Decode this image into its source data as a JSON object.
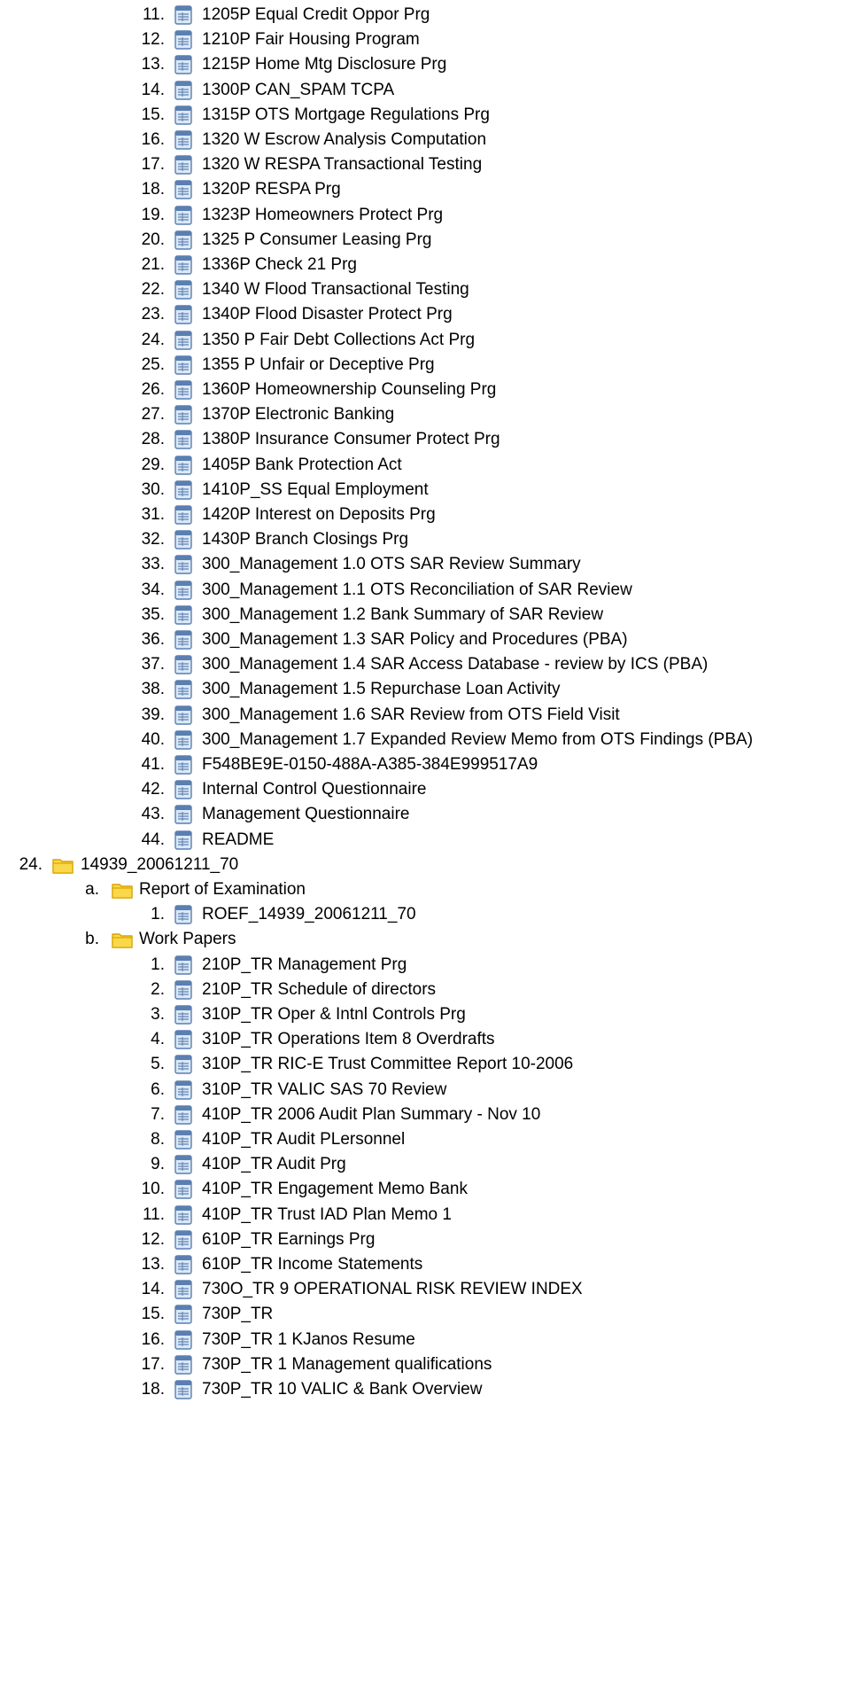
{
  "icons": {
    "folder": "folder-icon",
    "document": "document-icon"
  },
  "colors": {
    "folder_fill": "#f9d94a",
    "folder_edge": "#d9a400",
    "doc_fill": "#dbe8f6",
    "doc_edge": "#5a7fb0"
  },
  "rows": [
    {
      "level": 2,
      "num": "11.",
      "icon": "document",
      "text": "1205P Equal Credit Oppor Prg"
    },
    {
      "level": 2,
      "num": "12.",
      "icon": "document",
      "text": "1210P Fair Housing Program"
    },
    {
      "level": 2,
      "num": "13.",
      "icon": "document",
      "text": "1215P Home Mtg Disclosure Prg"
    },
    {
      "level": 2,
      "num": "14.",
      "icon": "document",
      "text": "1300P CAN_SPAM TCPA"
    },
    {
      "level": 2,
      "num": "15.",
      "icon": "document",
      "text": "1315P OTS Mortgage Regulations Prg"
    },
    {
      "level": 2,
      "num": "16.",
      "icon": "document",
      "text": "1320 W Escrow Analysis Computation"
    },
    {
      "level": 2,
      "num": "17.",
      "icon": "document",
      "text": "1320 W RESPA Transactional Testing"
    },
    {
      "level": 2,
      "num": "18.",
      "icon": "document",
      "text": "1320P RESPA Prg"
    },
    {
      "level": 2,
      "num": "19.",
      "icon": "document",
      "text": "1323P Homeowners Protect Prg"
    },
    {
      "level": 2,
      "num": "20.",
      "icon": "document",
      "text": "1325 P Consumer Leasing Prg"
    },
    {
      "level": 2,
      "num": "21.",
      "icon": "document",
      "text": "1336P Check 21 Prg"
    },
    {
      "level": 2,
      "num": "22.",
      "icon": "document",
      "text": "1340 W Flood Transactional Testing"
    },
    {
      "level": 2,
      "num": "23.",
      "icon": "document",
      "text": "1340P Flood Disaster Protect Prg"
    },
    {
      "level": 2,
      "num": "24.",
      "icon": "document",
      "text": "1350 P Fair Debt Collections Act Prg"
    },
    {
      "level": 2,
      "num": "25.",
      "icon": "document",
      "text": "1355 P Unfair or Deceptive Prg"
    },
    {
      "level": 2,
      "num": "26.",
      "icon": "document",
      "text": "1360P Homeownership Counseling Prg"
    },
    {
      "level": 2,
      "num": "27.",
      "icon": "document",
      "text": "1370P Electronic Banking"
    },
    {
      "level": 2,
      "num": "28.",
      "icon": "document",
      "text": "1380P Insurance Consumer Protect Prg"
    },
    {
      "level": 2,
      "num": "29.",
      "icon": "document",
      "text": "1405P Bank Protection Act"
    },
    {
      "level": 2,
      "num": "30.",
      "icon": "document",
      "text": "1410P_SS Equal Employment"
    },
    {
      "level": 2,
      "num": "31.",
      "icon": "document",
      "text": "1420P Interest on Deposits Prg"
    },
    {
      "level": 2,
      "num": "32.",
      "icon": "document",
      "text": "1430P Branch Closings Prg"
    },
    {
      "level": 2,
      "num": "33.",
      "icon": "document",
      "text": "300_Management 1.0 OTS SAR Review Summary"
    },
    {
      "level": 2,
      "num": "34.",
      "icon": "document",
      "text": "300_Management 1.1 OTS Reconciliation of SAR Review"
    },
    {
      "level": 2,
      "num": "35.",
      "icon": "document",
      "text": "300_Management 1.2 Bank Summary of SAR Review"
    },
    {
      "level": 2,
      "num": "36.",
      "icon": "document",
      "text": "300_Management 1.3 SAR Policy and Procedures (PBA)"
    },
    {
      "level": 2,
      "num": "37.",
      "icon": "document",
      "text": "300_Management 1.4 SAR Access Database - review by ICS (PBA)"
    },
    {
      "level": 2,
      "num": "38.",
      "icon": "document",
      "text": "300_Management 1.5 Repurchase Loan Activity"
    },
    {
      "level": 2,
      "num": "39.",
      "icon": "document",
      "text": "300_Management 1.6 SAR Review from OTS Field Visit"
    },
    {
      "level": 2,
      "num": "40.",
      "icon": "document",
      "text": "300_Management 1.7 Expanded Review Memo from OTS Findings (PBA)"
    },
    {
      "level": 2,
      "num": "41.",
      "icon": "document",
      "text": "F548BE9E-0150-488A-A385-384E999517A9"
    },
    {
      "level": 2,
      "num": "42.",
      "icon": "document",
      "text": "Internal Control Questionnaire"
    },
    {
      "level": 2,
      "num": "43.",
      "icon": "document",
      "text": "Management Questionnaire"
    },
    {
      "level": 2,
      "num": "44.",
      "icon": "document",
      "text": "README"
    },
    {
      "level": 0,
      "num": "24.",
      "icon": "folder",
      "text": "14939_20061211_70"
    },
    {
      "level": 1,
      "num": "a.",
      "icon": "folder",
      "text": "Report of Examination"
    },
    {
      "level": 2,
      "num": "1.",
      "icon": "document",
      "text": "ROEF_14939_20061211_70"
    },
    {
      "level": 1,
      "num": "b.",
      "icon": "folder",
      "text": "Work Papers"
    },
    {
      "level": 2,
      "num": "1.",
      "icon": "document",
      "text": "210P_TR Management Prg"
    },
    {
      "level": 2,
      "num": "2.",
      "icon": "document",
      "text": "210P_TR Schedule of directors"
    },
    {
      "level": 2,
      "num": "3.",
      "icon": "document",
      "text": "310P_TR Oper & Intnl Controls Prg"
    },
    {
      "level": 2,
      "num": "4.",
      "icon": "document",
      "text": "310P_TR Operations Item 8 Overdrafts"
    },
    {
      "level": 2,
      "num": "5.",
      "icon": "document",
      "text": "310P_TR RIC-E Trust Committee Report 10-2006"
    },
    {
      "level": 2,
      "num": "6.",
      "icon": "document",
      "text": "310P_TR VALIC SAS 70 Review"
    },
    {
      "level": 2,
      "num": "7.",
      "icon": "document",
      "text": "410P_TR 2006 Audit Plan Summary - Nov 10"
    },
    {
      "level": 2,
      "num": "8.",
      "icon": "document",
      "text": "410P_TR Audit PLersonnel"
    },
    {
      "level": 2,
      "num": "9.",
      "icon": "document",
      "text": "410P_TR Audit Prg"
    },
    {
      "level": 2,
      "num": "10.",
      "icon": "document",
      "text": "410P_TR Engagement Memo Bank"
    },
    {
      "level": 2,
      "num": "11.",
      "icon": "document",
      "text": "410P_TR Trust IAD Plan Memo 1"
    },
    {
      "level": 2,
      "num": "12.",
      "icon": "document",
      "text": "610P_TR Earnings Prg"
    },
    {
      "level": 2,
      "num": "13.",
      "icon": "document",
      "text": "610P_TR Income Statements"
    },
    {
      "level": 2,
      "num": "14.",
      "icon": "document",
      "text": "730O_TR 9 OPERATIONAL RISK REVIEW INDEX"
    },
    {
      "level": 2,
      "num": "15.",
      "icon": "document",
      "text": "730P_TR"
    },
    {
      "level": 2,
      "num": "16.",
      "icon": "document",
      "text": "730P_TR 1 KJanos Resume"
    },
    {
      "level": 2,
      "num": "17.",
      "icon": "document",
      "text": "730P_TR 1 Management qualifications"
    },
    {
      "level": 2,
      "num": "18.",
      "icon": "document",
      "text": "730P_TR 10 VALIC & Bank Overview"
    }
  ]
}
